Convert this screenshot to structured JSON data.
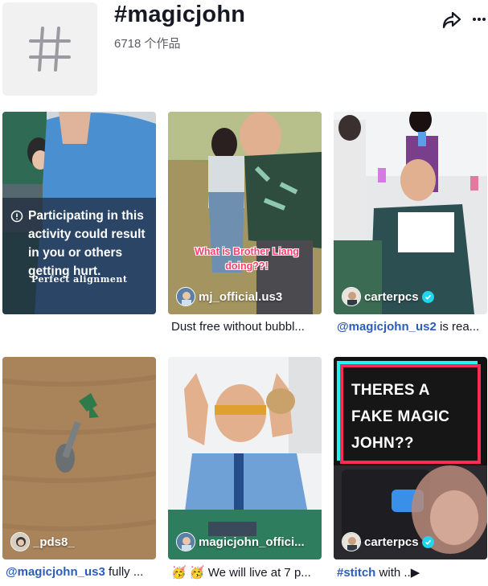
{
  "hashtag": {
    "title": "#magicjohn",
    "count": "6718 个作品"
  },
  "icons": {
    "hashtag": "hash-icon",
    "share": "share-arrow-icon",
    "more": "more-dots-icon",
    "warning": "info-circle-icon",
    "verified": "verified-check-icon"
  },
  "videos": [
    {
      "warning": "Participating in this activity could result in you or others getting hurt.",
      "overlay_text": "Perfect alignment",
      "caption": ""
    },
    {
      "author": "mj_official.us3",
      "overlay_text": "What is Brother Liang doing??!",
      "caption": "Dust free without bubbl..."
    },
    {
      "author": "carterpcs",
      "verified": true,
      "caption_mention": "@magicjohn_us2",
      "caption": " is rea..."
    },
    {
      "author": "_pds8_",
      "caption_mention": "@magicjohn_us3",
      "caption": " fully ..."
    },
    {
      "author": "magicjohn_offici...",
      "caption": "🥳 🥳 We will live at 7 p..."
    },
    {
      "author": "carterpcs",
      "verified": true,
      "overlay_text": "THERES A FAKE MAGIC JOHN??",
      "caption_mention": "#stitch",
      "caption": " with ..▶"
    }
  ],
  "colors": {
    "mention": "#2b5db9",
    "verified": "#20d5ec",
    "accent_red": "#fe2c55",
    "accent_cyan": "#25f4ee"
  }
}
